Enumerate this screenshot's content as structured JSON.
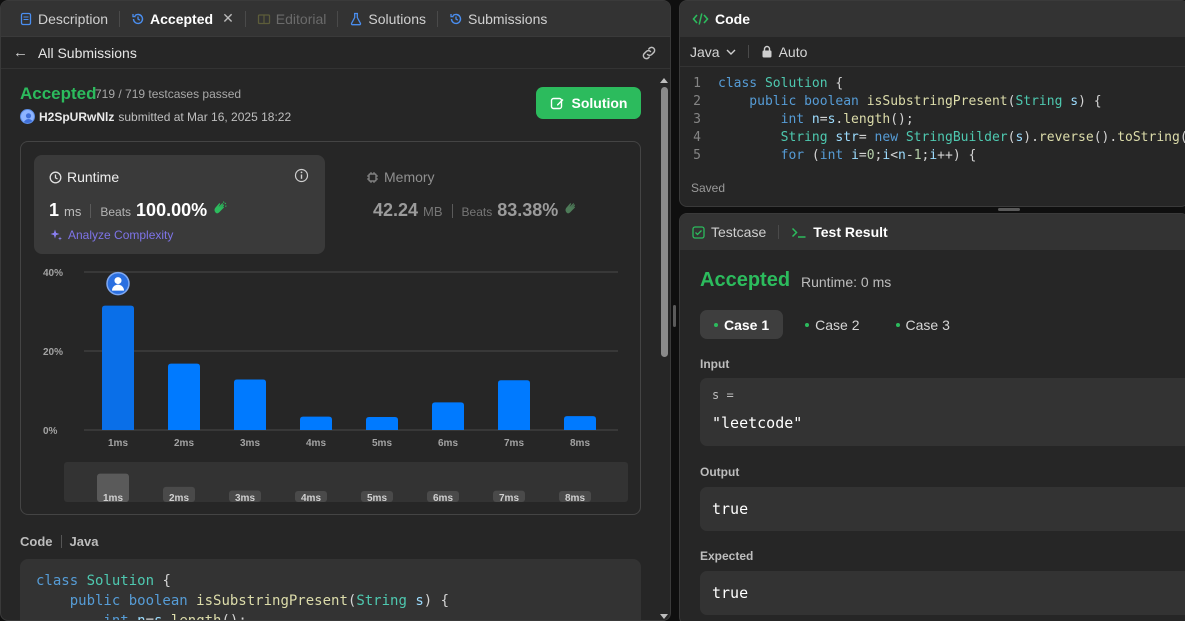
{
  "tabs": [
    {
      "label": "Description",
      "state": "normal"
    },
    {
      "label": "Accepted",
      "state": "active"
    },
    {
      "label": "Editorial",
      "state": "disabled"
    },
    {
      "label": "Solutions",
      "state": "normal"
    },
    {
      "label": "Submissions",
      "state": "normal"
    }
  ],
  "submission": {
    "back_label": "All Submissions",
    "status": "Accepted",
    "testcases": "719 / 719 testcases passed",
    "author": "H2SpURwNlz",
    "submitted_text": "submitted at Mar 16, 2025 18:22",
    "solution_button": "Solution"
  },
  "runtime": {
    "title": "Runtime",
    "value": "1",
    "unit": "ms",
    "beats_label": "Beats",
    "beats_value": "100.00%",
    "analyze_label": "Analyze Complexity"
  },
  "memory": {
    "title": "Memory",
    "value": "42.24",
    "unit": "MB",
    "beats_label": "Beats",
    "beats_value": "83.38%"
  },
  "chart_data": {
    "type": "bar",
    "categories": [
      "1ms",
      "2ms",
      "3ms",
      "4ms",
      "5ms",
      "6ms",
      "7ms",
      "8ms"
    ],
    "values": [
      31.5,
      16.8,
      12.8,
      3.4,
      3.3,
      7.0,
      12.6,
      3.5
    ],
    "yticks": [
      "0%",
      "20%",
      "40%"
    ],
    "ylim": [
      0,
      40
    ],
    "highlight_index": 0,
    "bar_color": "#007aff",
    "grid": true
  },
  "code_section": {
    "label": "Code",
    "language": "Java",
    "preview_lines": [
      [
        {
          "t": "class ",
          "c": "kw"
        },
        {
          "t": "Solution",
          "c": "cls"
        },
        {
          "t": " {",
          "c": "pl"
        }
      ],
      [
        {
          "t": "    public ",
          "c": "kw"
        },
        {
          "t": "boolean ",
          "c": "kw"
        },
        {
          "t": "isSubstringPresent",
          "c": "fn"
        },
        {
          "t": "(",
          "c": "pl"
        },
        {
          "t": "String ",
          "c": "cls"
        },
        {
          "t": "s",
          "c": "var"
        },
        {
          "t": ") {",
          "c": "pl"
        }
      ],
      [
        {
          "t": "        int ",
          "c": "kw"
        },
        {
          "t": "n",
          "c": "var"
        },
        {
          "t": "=",
          "c": "pl"
        },
        {
          "t": "s",
          "c": "var"
        },
        {
          "t": ".",
          "c": "pl"
        },
        {
          "t": "length",
          "c": "fn"
        },
        {
          "t": "();",
          "c": "pl"
        }
      ]
    ]
  },
  "editor": {
    "title": "Code",
    "language": "Java",
    "mode": "Auto",
    "saved": "Saved",
    "lines": [
      {
        "n": "1",
        "tokens": [
          {
            "t": "class ",
            "c": "kw"
          },
          {
            "t": "Solution",
            "c": "cls"
          },
          {
            "t": " {",
            "c": "pl"
          }
        ]
      },
      {
        "n": "2",
        "tokens": [
          {
            "t": "    public ",
            "c": "kw"
          },
          {
            "t": "boolean ",
            "c": "kw"
          },
          {
            "t": "isSubstringPresent",
            "c": "fn"
          },
          {
            "t": "(",
            "c": "pl"
          },
          {
            "t": "String ",
            "c": "cls"
          },
          {
            "t": "s",
            "c": "var"
          },
          {
            "t": ") {",
            "c": "pl"
          }
        ]
      },
      {
        "n": "3",
        "tokens": [
          {
            "t": "        int ",
            "c": "kw"
          },
          {
            "t": "n",
            "c": "var"
          },
          {
            "t": "=",
            "c": "pl"
          },
          {
            "t": "s",
            "c": "var"
          },
          {
            "t": ".",
            "c": "pl"
          },
          {
            "t": "length",
            "c": "fn"
          },
          {
            "t": "();",
            "c": "pl"
          }
        ]
      },
      {
        "n": "4",
        "tokens": [
          {
            "t": "        String ",
            "c": "cls"
          },
          {
            "t": "str",
            "c": "var"
          },
          {
            "t": "= ",
            "c": "pl"
          },
          {
            "t": "new ",
            "c": "kw"
          },
          {
            "t": "StringBuilder",
            "c": "cls"
          },
          {
            "t": "(",
            "c": "pl"
          },
          {
            "t": "s",
            "c": "var"
          },
          {
            "t": ").",
            "c": "pl"
          },
          {
            "t": "reverse",
            "c": "fn"
          },
          {
            "t": "().",
            "c": "pl"
          },
          {
            "t": "toString",
            "c": "fn"
          },
          {
            "t": "();",
            "c": "pl"
          }
        ]
      },
      {
        "n": "5",
        "tokens": [
          {
            "t": "        for ",
            "c": "kw"
          },
          {
            "t": "(",
            "c": "pl"
          },
          {
            "t": "int ",
            "c": "kw"
          },
          {
            "t": "i",
            "c": "var"
          },
          {
            "t": "=",
            "c": "pl"
          },
          {
            "t": "0",
            "c": "num"
          },
          {
            "t": ";",
            "c": "pl"
          },
          {
            "t": "i",
            "c": "var"
          },
          {
            "t": "<",
            "c": "pl"
          },
          {
            "t": "n",
            "c": "var"
          },
          {
            "t": "-",
            "c": "pl"
          },
          {
            "t": "1",
            "c": "num"
          },
          {
            "t": ";",
            "c": "pl"
          },
          {
            "t": "i",
            "c": "var"
          },
          {
            "t": "++) {",
            "c": "pl"
          }
        ]
      }
    ]
  },
  "testpanel": {
    "tab_testcase": "Testcase",
    "tab_result": "Test Result",
    "status": "Accepted",
    "runtime": "Runtime: 0 ms",
    "cases": [
      "Case 1",
      "Case 2",
      "Case 3"
    ],
    "input_label": "Input",
    "input_var": "s =",
    "input_value": "\"leetcode\"",
    "output_label": "Output",
    "output_value": "true",
    "expected_label": "Expected",
    "expected_value": "true"
  },
  "colors": {
    "accent_green": "#2cbb5d",
    "bar_blue": "#007aff",
    "analyze_purple": "#7e74e8"
  }
}
